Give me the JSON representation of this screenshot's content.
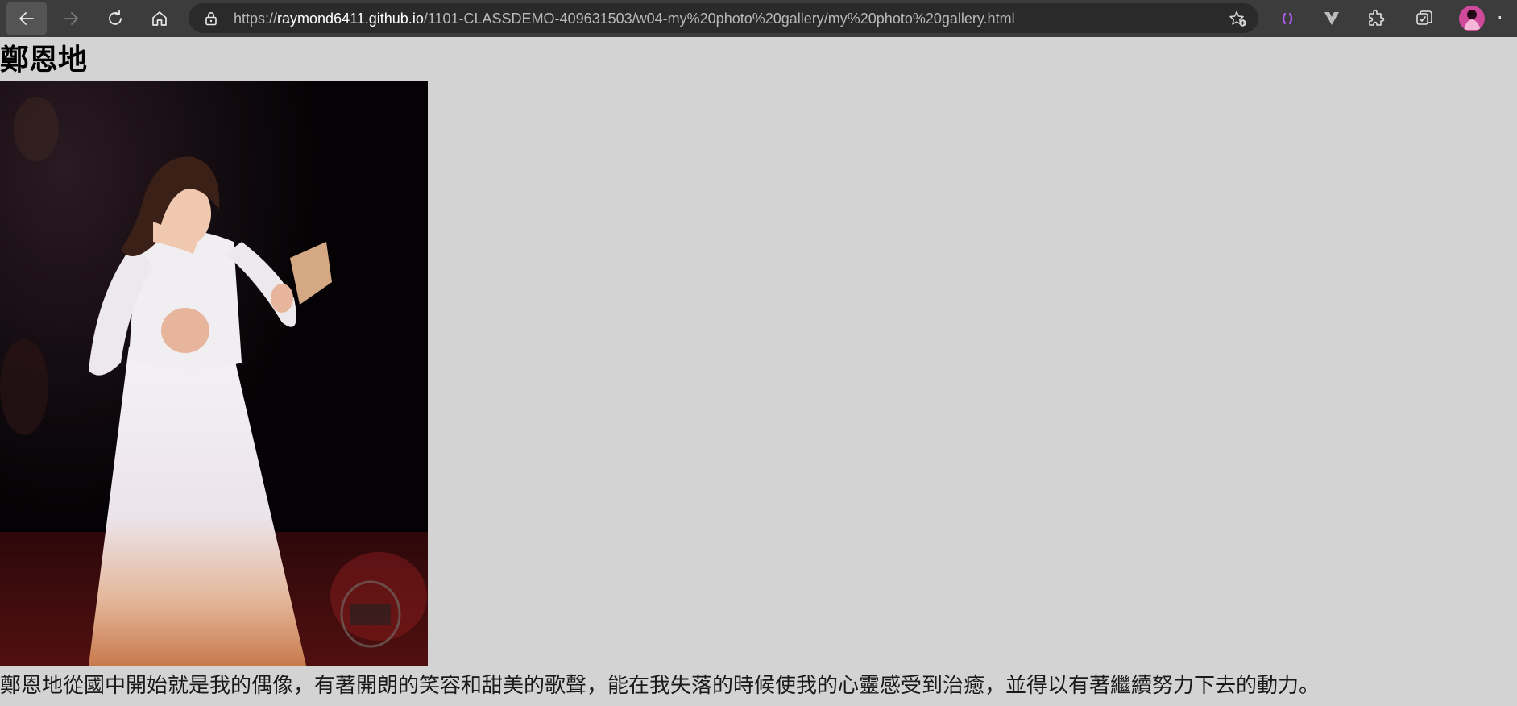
{
  "browser": {
    "url_prefix": "https://",
    "url_host": "raymond6411.github.io",
    "url_path": "/1101-CLASSDEMO-409631503/w04-my%20photo%20gallery/my%20photo%20gallery.html",
    "icons": {
      "back": "back-arrow-icon",
      "forward": "forward-arrow-icon",
      "refresh": "refresh-icon",
      "home": "home-icon",
      "lock": "lock-icon",
      "favorite": "add-favorite-icon",
      "extensions": [
        "purple-bracket-extension-icon",
        "v-extension-icon",
        "puzzle-extensions-icon",
        "collections-icon"
      ],
      "profile": "profile-avatar",
      "more": "more-options-icon"
    }
  },
  "page": {
    "title": "鄭恩地",
    "caption": "鄭恩地從國中開始就是我的偶像，有著開朗的笑容和甜美的歌聲，能在我失落的時候使我的心靈感受到治癒，並得以有著繼續努力下去的動力。",
    "background_color": "#d3d3d3"
  }
}
